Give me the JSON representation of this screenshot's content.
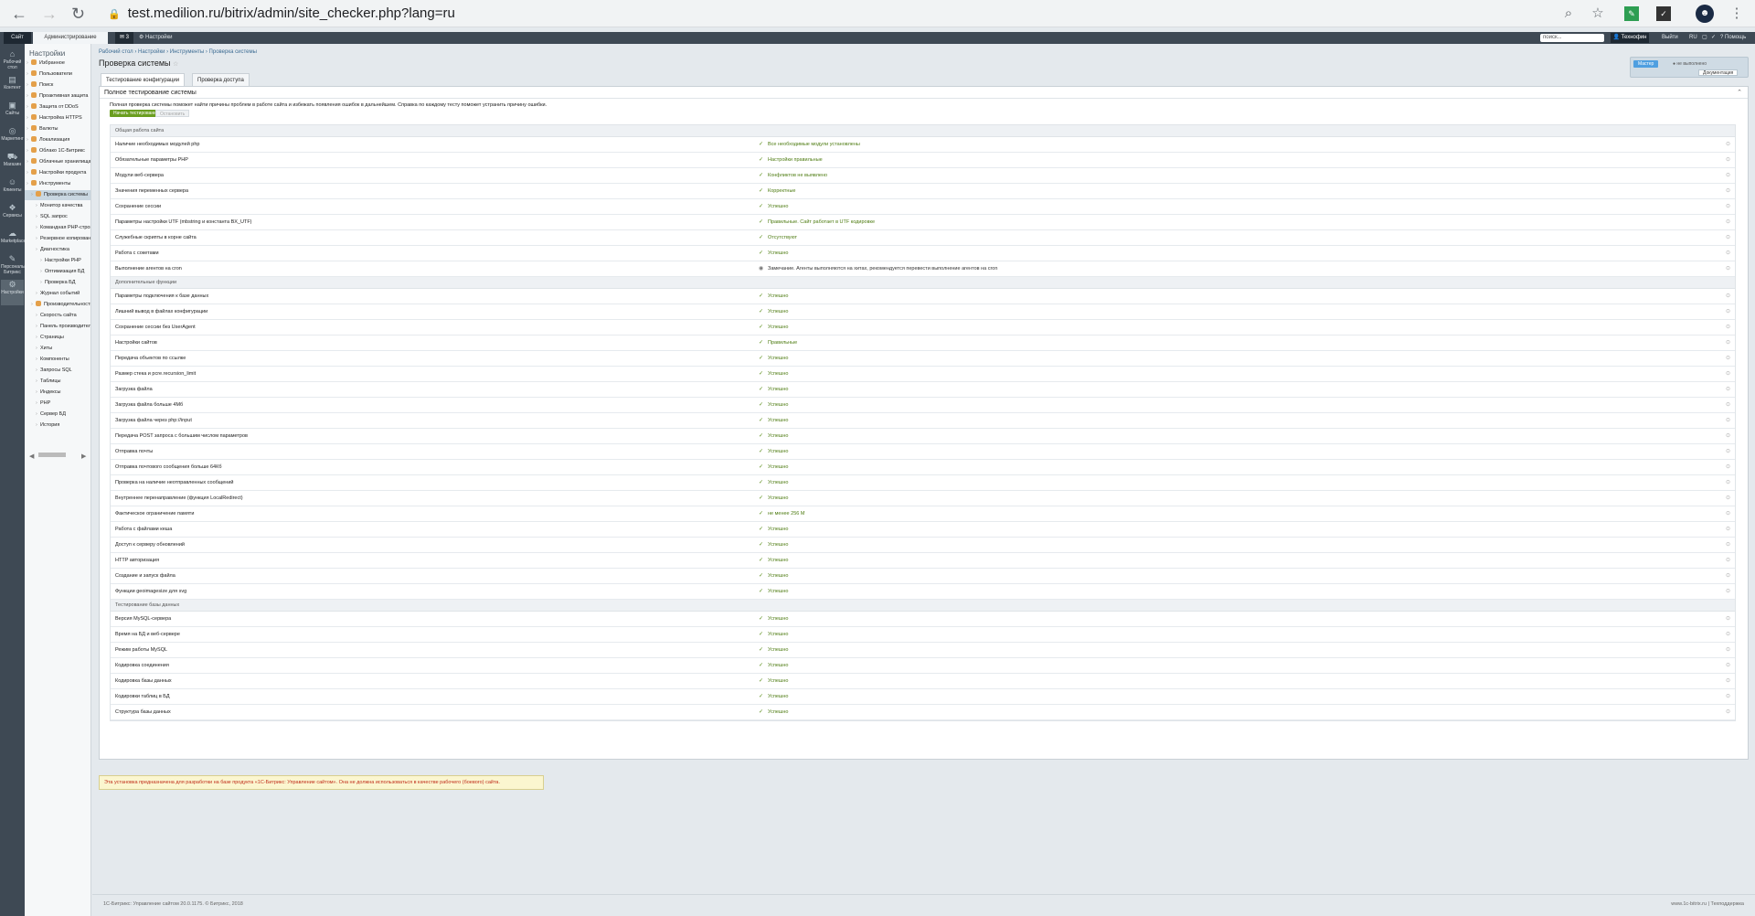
{
  "browser": {
    "url": "test.medilion.ru/bitrix/admin/site_checker.php?lang=ru"
  },
  "topbar": {
    "site_tab": "Сайт",
    "admin_tab": "Администрирование",
    "notif_count": "3",
    "settings_label": "Настройки",
    "search_placeholder": "поиск...",
    "user": "Технофин",
    "logout": "Выйти",
    "lang": "RU",
    "help": "Помощь"
  },
  "leftbar": {
    "items": [
      "Рабочий стол",
      "Контент",
      "Сайты",
      "Маркетинг",
      "Магазин",
      "Клиенты",
      "Сервисы",
      "Marketplace",
      "Персональный Битрикс",
      "Настройки"
    ]
  },
  "menu": {
    "title": "Настройки",
    "items": [
      "Избранное",
      "Пользователи",
      "Поиск",
      "Проактивная защита",
      "Защита от DDoS",
      "Настройка HTTPS",
      "Валюты",
      "Локализация",
      "Облако 1С-Битрикс",
      "Облачные хранилища",
      "Настройки продукта",
      "Инструменты",
      "Проверка системы",
      "Монитор качества",
      "SQL запрос",
      "Командная PHP-строка",
      "Резервное копирование",
      "Диагностика",
      "Настройки PHP",
      "Оптимизация БД",
      "Проверка БД",
      "Журнал событий",
      "Производительность",
      "Скорость сайта",
      "Панель производительности",
      "Страницы",
      "Хиты",
      "Компоненты",
      "Запросы SQL",
      "Таблицы",
      "Индексы",
      "PHP",
      "Сервер БД",
      "История"
    ]
  },
  "breadcrumb": [
    "Рабочий стол",
    "Настройки",
    "Инструменты",
    "Проверка системы"
  ],
  "page": {
    "title": "Проверка системы",
    "tabs": [
      "Тестирование конфигурации",
      "Проверка доступа"
    ],
    "master_button": "Мастер",
    "status": "не выполнено",
    "doc_button": "Документация",
    "panel_title": "Полное тестирование системы",
    "description": "Полная проверка системы поможет найти причины проблем в работе сайта и избежать появления ошибок в дальнейшем. Справка по каждому тесту поможет устранить причину ошибки.",
    "start_button": "Начать тестирование",
    "stop_button": "Остановить"
  },
  "results": {
    "section1": "Общая работа сайта",
    "rows1": [
      {
        "name": "Наличие необходимых модулей php",
        "result": "Все необходимые модули установлены"
      },
      {
        "name": "Обязательные параметры PHP",
        "result": "Настройки правильные"
      },
      {
        "name": "Модули веб-сервера",
        "result": "Конфликтов не выявлено"
      },
      {
        "name": "Значения переменных сервера",
        "result": "Корректные"
      },
      {
        "name": "Сохранение сессии",
        "result": "Успешно"
      },
      {
        "name": "Параметры настройки UTF (mbstring и константа BX_UTF)",
        "result": "Правильные. Сайт работает в UTF кодировке"
      },
      {
        "name": "Служебные скрипты в корне сайта",
        "result": "Отсутствуют"
      },
      {
        "name": "Работа с сокетами",
        "result": "Успешно"
      },
      {
        "name": "Выполнение агентов на cron",
        "result": "Замечание. Агенты выполняются на хитах, рекомендуется перевести выполнение агентов на cron"
      }
    ],
    "section2": "Дополнительные функции",
    "rows2": [
      {
        "name": "Параметры подключения к базе данных",
        "result": "Успешно"
      },
      {
        "name": "Лишний вывод в файлах конфигурации",
        "result": "Успешно"
      },
      {
        "name": "Сохранение сессии без UserAgent",
        "result": "Успешно"
      },
      {
        "name": "Настройки сайтов",
        "result": "Правильные"
      },
      {
        "name": "Передача объектов по ссылке",
        "result": "Успешно"
      },
      {
        "name": "Размер стека и pcre.recursion_limit",
        "result": "Успешно"
      },
      {
        "name": "Загрузка файла",
        "result": "Успешно"
      },
      {
        "name": "Загрузка файла больше 4Мб",
        "result": "Успешно"
      },
      {
        "name": "Загрузка файла через php://input",
        "result": "Успешно"
      },
      {
        "name": "Передача POST запроса с большим числом параметров",
        "result": "Успешно"
      },
      {
        "name": "Отправка почты",
        "result": "Успешно"
      },
      {
        "name": "Отправка почтового сообщения больше 64Кб",
        "result": "Успешно"
      },
      {
        "name": "Проверка на наличие неотправленных сообщений",
        "result": "Успешно"
      },
      {
        "name": "Внутреннее перенаправление (функция LocalRedirect)",
        "result": "Успешно"
      },
      {
        "name": "Фактическое ограничение памяти",
        "result": "не менее 256 M"
      },
      {
        "name": "Работа с файлами кеша",
        "result": "Успешно"
      },
      {
        "name": "Доступ к серверу обновлений",
        "result": "Успешно"
      },
      {
        "name": "HTTP авторизация",
        "result": "Успешно"
      },
      {
        "name": "Создание и запуск файла",
        "result": "Успешно"
      },
      {
        "name": "Функции geoimagesize для svg",
        "result": "Успешно"
      }
    ],
    "section3": "Тестирование базы данных",
    "rows3": [
      {
        "name": "Версия MySQL-сервера",
        "result": "Успешно"
      },
      {
        "name": "Время на БД и веб-сервере",
        "result": "Успешно"
      },
      {
        "name": "Режим работы MySQL",
        "result": "Успешно"
      },
      {
        "name": "Кодировка соединения",
        "result": "Успешно"
      },
      {
        "name": "Кодировка базы данных",
        "result": "Успешно"
      },
      {
        "name": "Кодировки таблиц в БД",
        "result": "Успешно"
      },
      {
        "name": "Структура базы данных",
        "result": "Успешно"
      }
    ]
  },
  "dev_note": "Эта установка предназначена для разработки на базе продукта «1С-Битрикс: Управление сайтом». Она не должна использоваться в качестве рабочего (боевого) сайта.",
  "footer": {
    "left": "1С-Битрикс: Управление сайтом 20.0.1175. © Битрикс, 2018",
    "right": "www.1c-bitrix.ru | Техподдержка"
  },
  "colors": {
    "ok": "#5b8e1b",
    "admin_bar": "#3e4954",
    "start_button": "#6a9e1f",
    "dev_note_text": "#c02d1a"
  }
}
